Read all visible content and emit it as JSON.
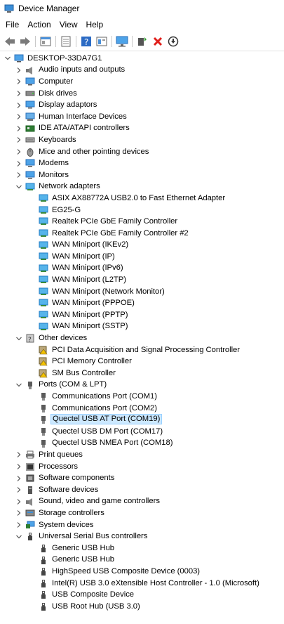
{
  "window": {
    "title": "Device Manager"
  },
  "menu": [
    "File",
    "Action",
    "View",
    "Help"
  ],
  "toolbar": [
    "back-icon",
    "forward-icon",
    "sep",
    "properties-icon",
    "sep",
    "driver-list-icon",
    "sep",
    "help-icon",
    "console-icon",
    "sep",
    "monitor-icon",
    "sep",
    "scan-hardware-icon",
    "uninstall-icon",
    "update-driver-icon"
  ],
  "tree": [
    {
      "level": 0,
      "exp": "open",
      "icon": "computer",
      "label": "DESKTOP-33DA7G1"
    },
    {
      "level": 1,
      "exp": "closed",
      "icon": "audio",
      "label": "Audio inputs and outputs"
    },
    {
      "level": 1,
      "exp": "closed",
      "icon": "monitor",
      "label": "Computer"
    },
    {
      "level": 1,
      "exp": "closed",
      "icon": "disk",
      "label": "Disk drives"
    },
    {
      "level": 1,
      "exp": "closed",
      "icon": "monitor",
      "label": "Display adaptors"
    },
    {
      "level": 1,
      "exp": "closed",
      "icon": "hid",
      "label": "Human Interface Devices"
    },
    {
      "level": 1,
      "exp": "closed",
      "icon": "ide",
      "label": "IDE ATA/ATAPI controllers"
    },
    {
      "level": 1,
      "exp": "closed",
      "icon": "keyboard",
      "label": "Keyboards"
    },
    {
      "level": 1,
      "exp": "closed",
      "icon": "mouse",
      "label": "Mice and other pointing devices"
    },
    {
      "level": 1,
      "exp": "closed",
      "icon": "monitor",
      "label": "Modems"
    },
    {
      "level": 1,
      "exp": "closed",
      "icon": "monitor",
      "label": "Monitors"
    },
    {
      "level": 1,
      "exp": "open",
      "icon": "network",
      "label": "Network adapters"
    },
    {
      "level": 2,
      "icon": "network",
      "label": "ASIX AX88772A USB2.0 to Fast Ethernet Adapter"
    },
    {
      "level": 2,
      "icon": "network",
      "label": "EG25-G"
    },
    {
      "level": 2,
      "icon": "network",
      "label": "Realtek PCIe GbE Family Controller"
    },
    {
      "level": 2,
      "icon": "network",
      "label": "Realtek PCIe GbE Family Controller #2"
    },
    {
      "level": 2,
      "icon": "network",
      "label": "WAN Miniport (IKEv2)"
    },
    {
      "level": 2,
      "icon": "network",
      "label": "WAN Miniport (IP)"
    },
    {
      "level": 2,
      "icon": "network",
      "label": "WAN Miniport (IPv6)"
    },
    {
      "level": 2,
      "icon": "network",
      "label": "WAN Miniport (L2TP)"
    },
    {
      "level": 2,
      "icon": "network",
      "label": "WAN Miniport (Network Monitor)"
    },
    {
      "level": 2,
      "icon": "network",
      "label": "WAN Miniport (PPPOE)"
    },
    {
      "level": 2,
      "icon": "network",
      "label": "WAN Miniport (PPTP)"
    },
    {
      "level": 2,
      "icon": "network",
      "label": "WAN Miniport (SSTP)"
    },
    {
      "level": 1,
      "exp": "open",
      "icon": "unknown",
      "label": "Other devices"
    },
    {
      "level": 2,
      "icon": "warn",
      "label": "PCI Data Acquisition and Signal Processing Controller"
    },
    {
      "level": 2,
      "icon": "warn",
      "label": "PCI Memory Controller"
    },
    {
      "level": 2,
      "icon": "warn",
      "label": "SM Bus Controller"
    },
    {
      "level": 1,
      "exp": "open",
      "icon": "port",
      "label": "Ports (COM & LPT)"
    },
    {
      "level": 2,
      "icon": "port",
      "label": "Communications Port (COM1)"
    },
    {
      "level": 2,
      "icon": "port",
      "label": "Communications Port (COM2)"
    },
    {
      "level": 2,
      "icon": "port",
      "label": "Quectel USB AT Port (COM19)",
      "selected": true
    },
    {
      "level": 2,
      "icon": "port",
      "label": "Quectel USB DM Port (COM17)"
    },
    {
      "level": 2,
      "icon": "port",
      "label": "Quectel USB NMEA Port (COM18)"
    },
    {
      "level": 1,
      "exp": "closed",
      "icon": "printer",
      "label": "Print queues"
    },
    {
      "level": 1,
      "exp": "closed",
      "icon": "cpu",
      "label": "Processors"
    },
    {
      "level": 1,
      "exp": "closed",
      "icon": "software",
      "label": "Software components"
    },
    {
      "level": 1,
      "exp": "closed",
      "icon": "softdev",
      "label": "Software devices"
    },
    {
      "level": 1,
      "exp": "closed",
      "icon": "audio",
      "label": "Sound, video and game controllers"
    },
    {
      "level": 1,
      "exp": "closed",
      "icon": "storage",
      "label": "Storage controllers"
    },
    {
      "level": 1,
      "exp": "closed",
      "icon": "system",
      "label": "System devices"
    },
    {
      "level": 1,
      "exp": "open",
      "icon": "usb",
      "label": "Universal Serial Bus controllers"
    },
    {
      "level": 2,
      "icon": "usb",
      "label": "Generic USB Hub"
    },
    {
      "level": 2,
      "icon": "usb",
      "label": "Generic USB Hub"
    },
    {
      "level": 2,
      "icon": "usb",
      "label": "HighSpeed USB Composite Device (0003)"
    },
    {
      "level": 2,
      "icon": "usb",
      "label": "Intel(R) USB 3.0 eXtensible Host Controller - 1.0 (Microsoft)"
    },
    {
      "level": 2,
      "icon": "usb",
      "label": "USB Composite Device"
    },
    {
      "level": 2,
      "icon": "usb",
      "label": "USB Root Hub (USB 3.0)"
    }
  ]
}
